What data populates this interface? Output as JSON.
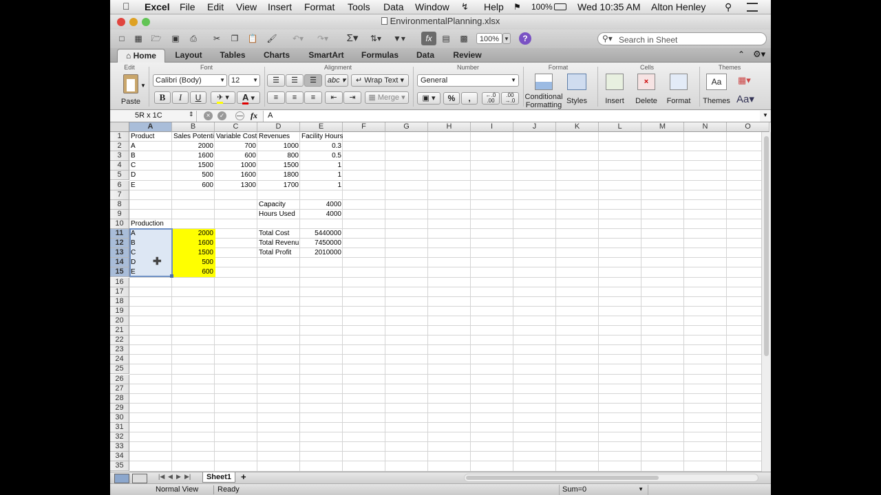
{
  "menubar": {
    "app": "Excel",
    "items": [
      "File",
      "Edit",
      "View",
      "Insert",
      "Format",
      "Tools",
      "Data",
      "Window",
      "Help"
    ],
    "battery": "100%",
    "clock": "Wed 10:35 AM",
    "user": "Alton Henley"
  },
  "window": {
    "title": "EnvironmentalPlanning.xlsx"
  },
  "toolbar": {
    "zoom": "100%",
    "search_placeholder": "Search in Sheet"
  },
  "ribbon_tabs": [
    "Home",
    "Layout",
    "Tables",
    "Charts",
    "SmartArt",
    "Formulas",
    "Data",
    "Review"
  ],
  "ribbon": {
    "groups": {
      "edit": "Edit",
      "font": "Font",
      "alignment": "Alignment",
      "number": "Number",
      "format": "Format",
      "cells": "Cells",
      "themes": "Themes"
    },
    "paste": "Paste",
    "font_name": "Calibri (Body)",
    "font_size": "12",
    "bold": "B",
    "italic": "I",
    "underline": "U",
    "wrap_text": "Wrap Text",
    "merge": "Merge",
    "number_format": "General",
    "percent": "%",
    "comma": ",",
    "cond_format_1": "Conditional",
    "cond_format_2": "Formatting",
    "styles": "Styles",
    "insert": "Insert",
    "delete": "Delete",
    "format": "Format",
    "themes": "Themes",
    "font_glyph": "Aa"
  },
  "formula_bar": {
    "name_box": "5R x 1C",
    "fx": "fx",
    "content": "A"
  },
  "grid": {
    "columns": [
      "A",
      "B",
      "C",
      "D",
      "E",
      "F",
      "G",
      "H",
      "I",
      "J",
      "K",
      "L",
      "M",
      "N",
      "O"
    ],
    "rows": [
      "1",
      "2",
      "3",
      "4",
      "5",
      "6",
      "7",
      "8",
      "9",
      "10",
      "11",
      "12",
      "13",
      "14",
      "15",
      "16",
      "17",
      "18",
      "19",
      "20",
      "21",
      "22",
      "23",
      "24",
      "25",
      "26",
      "27",
      "28",
      "29",
      "30",
      "31",
      "32",
      "33",
      "34",
      "35"
    ],
    "cells": {
      "A1": "Product",
      "B1": "Sales Potenti",
      "C1": "Variable Cost",
      "D1": "Revenues",
      "E1": "Facility Hours",
      "A2": "A",
      "B2": "2000",
      "C2": "700",
      "D2": "1000",
      "E2": "0.3",
      "A3": "B",
      "B3": "1600",
      "C3": "600",
      "D3": "800",
      "E3": "0.5",
      "A4": "C",
      "B4": "1500",
      "C4": "1000",
      "D4": "1500",
      "E4": "1",
      "A5": "D",
      "B5": "500",
      "C5": "1600",
      "D5": "1800",
      "E5": "1",
      "A6": "E",
      "B6": "600",
      "C6": "1300",
      "D6": "1700",
      "E6": "1",
      "D8": "Capacity",
      "E8": "4000",
      "D9": "Hours Used",
      "E9": "4000",
      "A10": "Production",
      "A11": "A",
      "B11": "2000",
      "D11": "Total Cost",
      "E11": "5440000",
      "A12": "B",
      "B12": "1600",
      "D12": "Total Revenu",
      "E12": "7450000",
      "A13": "C",
      "B13": "1500",
      "D13": "Total Profit",
      "E13": "2010000",
      "A14": "D",
      "B14": "500",
      "A15": "E",
      "B15": "600"
    }
  },
  "sheet_tabs": [
    "Sheet1"
  ],
  "add_sheet": "+",
  "status": {
    "view": "Normal View",
    "state": "Ready",
    "sum": "Sum=0"
  }
}
